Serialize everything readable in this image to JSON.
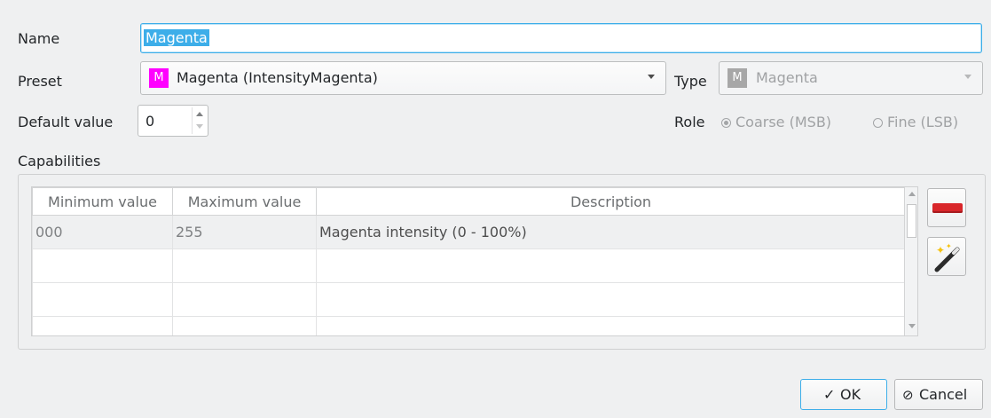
{
  "form": {
    "name_label": "Name",
    "name_value": "Magenta",
    "preset_label": "Preset",
    "preset_badge": "M",
    "preset_value": "Magenta (IntensityMagenta)",
    "type_label": "Type",
    "type_badge": "M",
    "type_value": "Magenta",
    "default_label": "Default value",
    "default_value": "0",
    "role_label": "Role",
    "role_coarse": "Coarse (MSB)",
    "role_fine": "Fine (LSB)",
    "capabilities_label": "Capabilities"
  },
  "table": {
    "headers": [
      "Minimum value",
      "Maximum value",
      "Description"
    ],
    "rows": [
      {
        "min": "000",
        "max": "255",
        "desc": "Magenta intensity (0 - 100%)"
      }
    ]
  },
  "buttons": {
    "ok": "OK",
    "cancel": "Cancel"
  },
  "colors": {
    "preset_swatch": "#ff00ff",
    "type_swatch": "#a7a7a7",
    "remove_button": "#d9262a"
  }
}
